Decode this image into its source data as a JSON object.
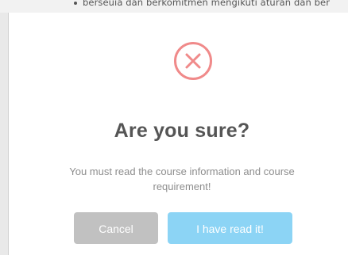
{
  "background": {
    "partial_text": "berseuia dan berkomitmen mengikuti aturan dan ber"
  },
  "dialog": {
    "icon": "error-x-circle-icon",
    "title": "Are you sure?",
    "message": "You must read the course information and course requirement!",
    "buttons": {
      "cancel_label": "Cancel",
      "confirm_label": "I have read it!"
    }
  },
  "colors": {
    "icon_red": "#f08a8a",
    "cancel_gray": "#c1c1c1",
    "confirm_blue": "#8cd4f5",
    "title_text": "#555555",
    "message_text": "#8d8d8d"
  }
}
